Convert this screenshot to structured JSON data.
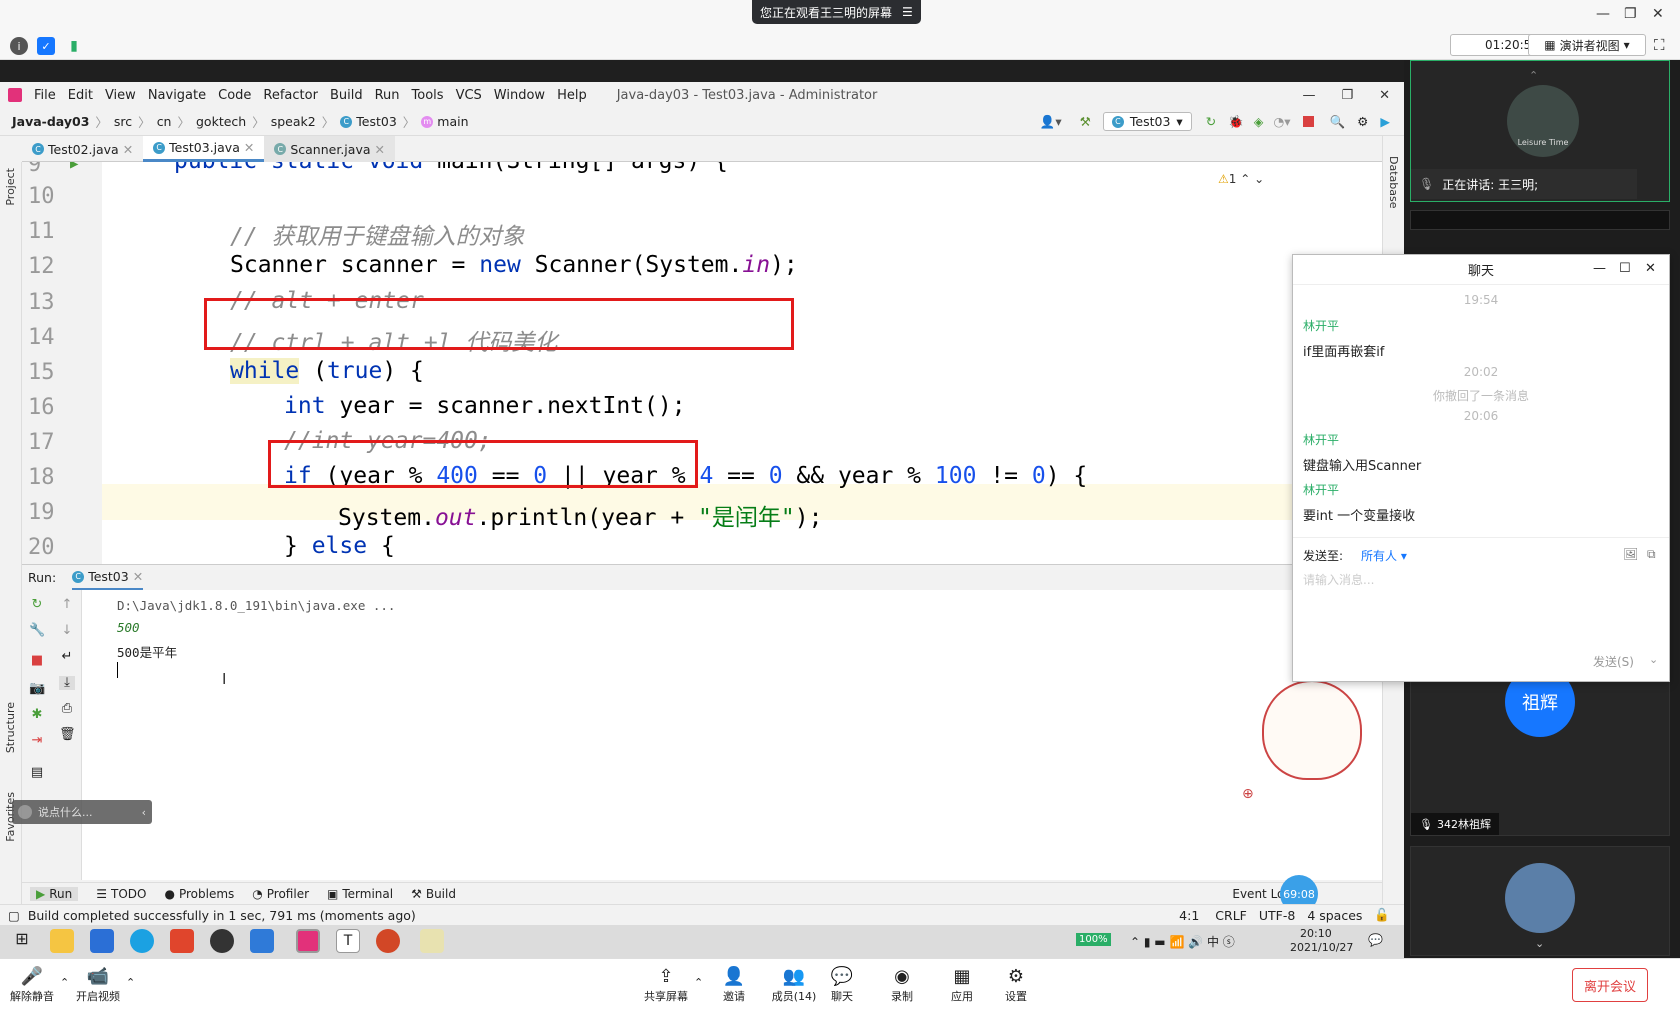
{
  "meeting": {
    "banner": "您正在观看王三明的屏幕",
    "timer": "01:20:55",
    "view_mode": "演讲者视图"
  },
  "ide": {
    "menu": [
      "File",
      "Edit",
      "View",
      "Navigate",
      "Code",
      "Refactor",
      "Build",
      "Run",
      "Tools",
      "VCS",
      "Window",
      "Help"
    ],
    "window_title": "Java-day03 - Test03.java - Administrator",
    "breadcrumb": [
      "Java-day03",
      "src",
      "cn",
      "goktech",
      "speak2",
      "Test03",
      "main"
    ],
    "run_config": "Test03",
    "tabs": [
      "Test02.java",
      "Test03.java",
      "Scanner.java"
    ],
    "left_tools": {
      "project": "Project",
      "structure": "Structure",
      "favorites": "Favorites"
    },
    "right_tools": {
      "database": "Database"
    },
    "warning_count": "1",
    "lines": [
      {
        "n": "9",
        "t": "public static void main(String[] args) {"
      },
      {
        "n": "10",
        "t": ""
      },
      {
        "n": "11",
        "t": "// 获取用于键盘输入的对象"
      },
      {
        "n": "12",
        "t": "Scanner scanner = new Scanner(System.in);"
      },
      {
        "n": "13",
        "t": "// alt + enter"
      },
      {
        "n": "14",
        "t": "// ctrl + alt +l 代码美化"
      },
      {
        "n": "15",
        "t": "while (true) {"
      },
      {
        "n": "16",
        "t": "int year = scanner.nextInt();"
      },
      {
        "n": "17",
        "t": "//int year=400;"
      },
      {
        "n": "18",
        "t": "if (year % 400 == 0 || year % 4 == 0 && year % 100 != 0) {"
      },
      {
        "n": "19",
        "t": "System.out.println(year + \"是闰年\");"
      },
      {
        "n": "20",
        "t": "} else {"
      }
    ],
    "run": {
      "label": "Run:",
      "tab": "Test03",
      "cmd": "D:\\Java\\jdk1.8.0_191\\bin\\java.exe ...",
      "input": "500",
      "output": "500是平年"
    },
    "say_placeholder": "说点什么...",
    "bottom_tabs": [
      "Run",
      "TODO",
      "Problems",
      "Profiler",
      "Terminal",
      "Build"
    ],
    "event_log": "Event Log",
    "status": "Build completed successfully in 1 sec, 791 ms (moments ago)",
    "status_right": [
      "4:1",
      "CRLF",
      "UTF-8",
      "4 spaces"
    ],
    "badge": "69:08"
  },
  "taskbar": {
    "battery": "100%",
    "time": "20:10",
    "date": "2021/10/27"
  },
  "chat": {
    "title": "聊天",
    "messages": [
      {
        "type": "time",
        "text": "19:54"
      },
      {
        "type": "name",
        "text": "林开平"
      },
      {
        "type": "msg",
        "text": "if里面再嵌套if"
      },
      {
        "type": "time",
        "text": "20:02"
      },
      {
        "type": "sys",
        "text": "你撤回了一条消息"
      },
      {
        "type": "time",
        "text": "20:06"
      },
      {
        "type": "name",
        "text": "林开平"
      },
      {
        "type": "msg",
        "text": "键盘输入用Scanner"
      },
      {
        "type": "name",
        "text": "林开平"
      },
      {
        "type": "msg",
        "text": "要int 一个变量接收"
      }
    ],
    "send_to_label": "发送至:",
    "send_to_value": "所有人",
    "input_placeholder": "请输入消息...",
    "send_button": "发送(S)"
  },
  "participants": {
    "speaking": "正在讲话: 王三明;",
    "avatar_name": "祖辉",
    "p2_label": "342林祖辉",
    "logo_text": "Leisure Time"
  },
  "meetbar": {
    "buttons": [
      "解除静音",
      "开启视频",
      "共享屏幕",
      "邀请",
      "成员(14)",
      "聊天",
      "录制",
      "应用",
      "设置"
    ],
    "leave": "离开会议"
  },
  "colors": {
    "accent": "#1677ff",
    "red_box": "#e21a1a",
    "chat_name": "#2aae67",
    "leave": "#e04040"
  }
}
